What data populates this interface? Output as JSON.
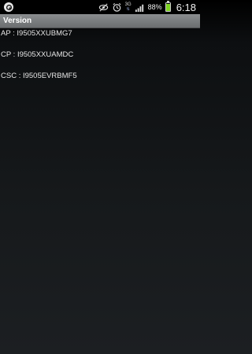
{
  "status_bar": {
    "network_type": "3G",
    "network_arrows": "⇅",
    "battery_percent": "88%",
    "battery_level": 0.88,
    "time": "6:18"
  },
  "app_bar": {
    "title": "Version"
  },
  "versions": [
    {
      "label": "AP : I9505XXUBMG7"
    },
    {
      "label": "CP : I9505XXUAMDC"
    },
    {
      "label": "CSC : I9505EVRBMF5"
    }
  ]
}
